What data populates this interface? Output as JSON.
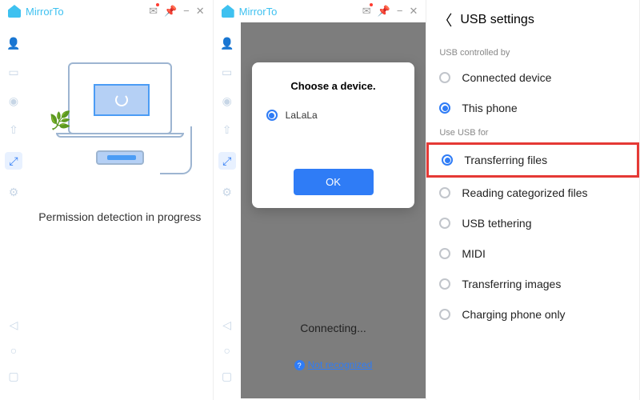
{
  "app": {
    "name": "MirrorTo"
  },
  "panel1": {
    "status": "Permission detection in progress"
  },
  "panel2": {
    "modal_title": "Choose a device.",
    "device": "LaLaLa",
    "ok": "OK",
    "connecting": "Connecting...",
    "not_recognized": "Not recognized"
  },
  "panel3": {
    "title": "USB settings",
    "section1": "USB controlled by",
    "opts1": [
      "Connected device",
      "This phone"
    ],
    "selected1": 1,
    "section2": "Use USB for",
    "opts2": [
      "Transferring files",
      "Reading categorized files",
      "USB tethering",
      "MIDI",
      "Transferring images",
      "Charging phone only"
    ],
    "selected2": 0
  }
}
